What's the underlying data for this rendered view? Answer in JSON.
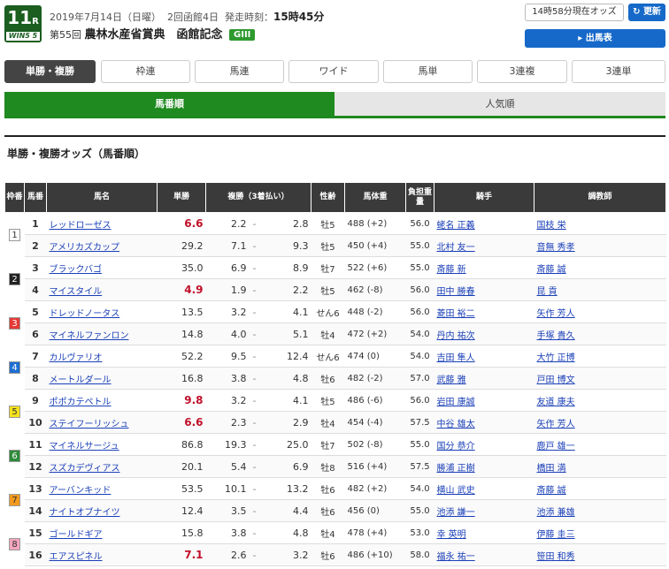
{
  "race": {
    "number": "11",
    "suffix": "R",
    "win5_label": "WIN5",
    "win5_num": "5",
    "date": "2019年7月14日（日曜）",
    "meet": "2回函館4日",
    "post_time_label": "発走時刻：",
    "post_time": "15時45分",
    "ordinal": "第55回",
    "name": "農林水産省賞典　函館記念",
    "grade": "GIII"
  },
  "header": {
    "odds_as_of": "14時58分現在オッズ",
    "refresh_label": "更新",
    "entries_label": "出馬表"
  },
  "bet_tabs": [
    "単勝・複勝",
    "枠連",
    "馬連",
    "ワイド",
    "馬単",
    "3連複",
    "3連単"
  ],
  "sort_tabs": {
    "by_number": "馬番順",
    "by_popularity": "人気順"
  },
  "section_title": "単勝・複勝オッズ（馬番順）",
  "columns": {
    "waku": "枠番",
    "uma": "馬番",
    "horse": "馬名",
    "win": "単勝",
    "place": "複勝（3着払い）",
    "sex_age": "性齢",
    "weight": "馬体重",
    "impost": "負担重量",
    "jockey": "騎手",
    "trainer": "調教師"
  },
  "waku_colors": {
    "1": {
      "bg": "#ffffff",
      "fg": "#333333"
    },
    "2": {
      "bg": "#222222",
      "fg": "#ffffff"
    },
    "3": {
      "bg": "#e53935",
      "fg": "#ffffff"
    },
    "4": {
      "bg": "#1e6fd0",
      "fg": "#ffffff"
    },
    "5": {
      "bg": "#f5e21b",
      "fg": "#333333"
    },
    "6": {
      "bg": "#2e8b3a",
      "fg": "#ffffff"
    },
    "7": {
      "bg": "#f39a1e",
      "fg": "#333333"
    },
    "8": {
      "bg": "#f5a6bf",
      "fg": "#333333"
    }
  },
  "rows": [
    {
      "waku": "1",
      "uma": "1",
      "horse": "レッドローゼス",
      "win": "6.6",
      "hot": true,
      "pmin": "2.2",
      "pmax": "2.8",
      "sex": "牡5",
      "weight": "488 (+2)",
      "impost": "56.0",
      "jockey": "蛯名 正義",
      "trainer": "国枝 栄"
    },
    {
      "waku": "",
      "uma": "2",
      "horse": "アメリカズカップ",
      "win": "29.2",
      "hot": false,
      "pmin": "7.1",
      "pmax": "9.3",
      "sex": "牡5",
      "weight": "450 (+4)",
      "impost": "55.0",
      "jockey": "北村 友一",
      "trainer": "音無 秀孝"
    },
    {
      "waku": "2",
      "uma": "3",
      "horse": "ブラックバゴ",
      "win": "35.0",
      "hot": false,
      "pmin": "6.9",
      "pmax": "8.9",
      "sex": "牡7",
      "weight": "522 (+6)",
      "impost": "55.0",
      "jockey": "斎藤 新",
      "trainer": "斎藤 誠"
    },
    {
      "waku": "",
      "uma": "4",
      "horse": "マイスタイル",
      "win": "4.9",
      "hot": true,
      "pmin": "1.9",
      "pmax": "2.2",
      "sex": "牡5",
      "weight": "462 (-8)",
      "impost": "56.0",
      "jockey": "田中 勝春",
      "trainer": "昆 貢"
    },
    {
      "waku": "3",
      "uma": "5",
      "horse": "ドレッドノータス",
      "win": "13.5",
      "hot": false,
      "pmin": "3.2",
      "pmax": "4.1",
      "sex": "せん6",
      "weight": "448 (-2)",
      "impost": "56.0",
      "jockey": "菱田 裕二",
      "trainer": "矢作 芳人"
    },
    {
      "waku": "",
      "uma": "6",
      "horse": "マイネルファンロン",
      "win": "14.8",
      "hot": false,
      "pmin": "4.0",
      "pmax": "5.1",
      "sex": "牡4",
      "weight": "472 (+2)",
      "impost": "54.0",
      "jockey": "丹内 祐次",
      "trainer": "手塚 貴久"
    },
    {
      "waku": "4",
      "uma": "7",
      "horse": "カルヴァリオ",
      "win": "52.2",
      "hot": false,
      "pmin": "9.5",
      "pmax": "12.4",
      "sex": "せん6",
      "weight": "474 (0)",
      "impost": "54.0",
      "jockey": "吉田 隼人",
      "trainer": "大竹 正博"
    },
    {
      "waku": "",
      "uma": "8",
      "horse": "メートルダール",
      "win": "16.8",
      "hot": false,
      "pmin": "3.8",
      "pmax": "4.8",
      "sex": "牡6",
      "weight": "482 (-2)",
      "impost": "57.0",
      "jockey": "武藤 雅",
      "trainer": "戸田 博文"
    },
    {
      "waku": "5",
      "uma": "9",
      "horse": "ポポカテペトル",
      "win": "9.8",
      "hot": true,
      "pmin": "3.2",
      "pmax": "4.1",
      "sex": "牡5",
      "weight": "486 (-6)",
      "impost": "56.0",
      "jockey": "岩田 康誠",
      "trainer": "友道 康夫"
    },
    {
      "waku": "",
      "uma": "10",
      "horse": "ステイフーリッシュ",
      "win": "6.6",
      "hot": true,
      "pmin": "2.3",
      "pmax": "2.9",
      "sex": "牡4",
      "weight": "454 (-4)",
      "impost": "57.5",
      "jockey": "中谷 雄太",
      "trainer": "矢作 芳人"
    },
    {
      "waku": "6",
      "uma": "11",
      "horse": "マイネルサージュ",
      "win": "86.8",
      "hot": false,
      "pmin": "19.3",
      "pmax": "25.0",
      "sex": "牡7",
      "weight": "502 (-8)",
      "impost": "55.0",
      "jockey": "国分 恭介",
      "trainer": "鹿戸 雄一"
    },
    {
      "waku": "",
      "uma": "12",
      "horse": "スズカデヴィアス",
      "win": "20.1",
      "hot": false,
      "pmin": "5.4",
      "pmax": "6.9",
      "sex": "牡8",
      "weight": "516 (+4)",
      "impost": "57.5",
      "jockey": "勝浦 正樹",
      "trainer": "橋田 満"
    },
    {
      "waku": "7",
      "uma": "13",
      "horse": "アーバンキッド",
      "win": "53.5",
      "hot": false,
      "pmin": "10.1",
      "pmax": "13.2",
      "sex": "牡6",
      "weight": "482 (+2)",
      "impost": "54.0",
      "jockey": "横山 武史",
      "trainer": "斎藤 誠"
    },
    {
      "waku": "",
      "uma": "14",
      "horse": "ナイトオブナイツ",
      "win": "12.4",
      "hot": false,
      "pmin": "3.5",
      "pmax": "4.4",
      "sex": "牡6",
      "weight": "456 (0)",
      "impost": "55.0",
      "jockey": "池添 謙一",
      "trainer": "池添 兼雄"
    },
    {
      "waku": "8",
      "uma": "15",
      "horse": "ゴールドギア",
      "win": "15.8",
      "hot": false,
      "pmin": "3.8",
      "pmax": "4.8",
      "sex": "牡4",
      "weight": "478 (+4)",
      "impost": "53.0",
      "jockey": "幸 英明",
      "trainer": "伊藤 圭三"
    },
    {
      "waku": "",
      "uma": "16",
      "horse": "エアスピネル",
      "win": "7.1",
      "hot": true,
      "pmin": "2.6",
      "pmax": "3.2",
      "sex": "牡6",
      "weight": "486 (+10)",
      "impost": "58.0",
      "jockey": "福永 祐一",
      "trainer": "笹田 和秀"
    }
  ]
}
